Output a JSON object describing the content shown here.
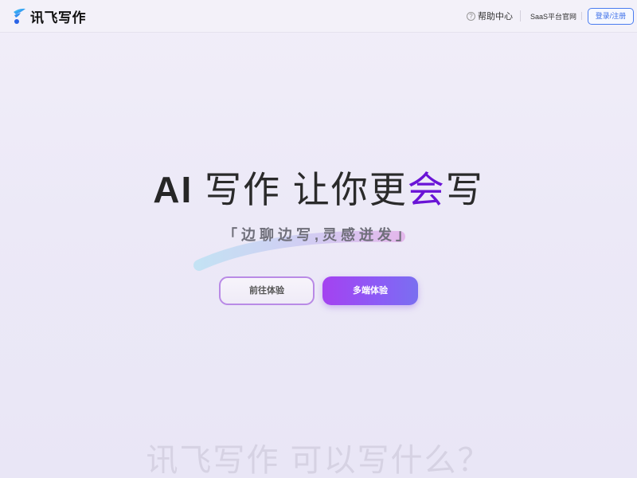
{
  "header": {
    "logo_text": "讯飞写作",
    "help_label": "帮助中心",
    "saas_label": "SaaS平台官网",
    "login_label": "登录/注册"
  },
  "hero": {
    "title_ai": "AI",
    "title_mid": " 写作 让你更",
    "title_accent": "会",
    "title_end": "写",
    "subtitle": "「边聊边写,灵感迸发」",
    "btn_try": "前往体验",
    "btn_multi": "多端体验"
  },
  "next_section": {
    "heading": "讯飞写作 可以写什么？"
  },
  "colors": {
    "accent": "#6a14d6",
    "login": "#3b6ee8",
    "button_gradient_start": "#a442f0",
    "button_gradient_end": "#7a6ff0"
  },
  "icons": {
    "logo": "xunfei-logo-icon",
    "help": "question-circle-icon"
  }
}
